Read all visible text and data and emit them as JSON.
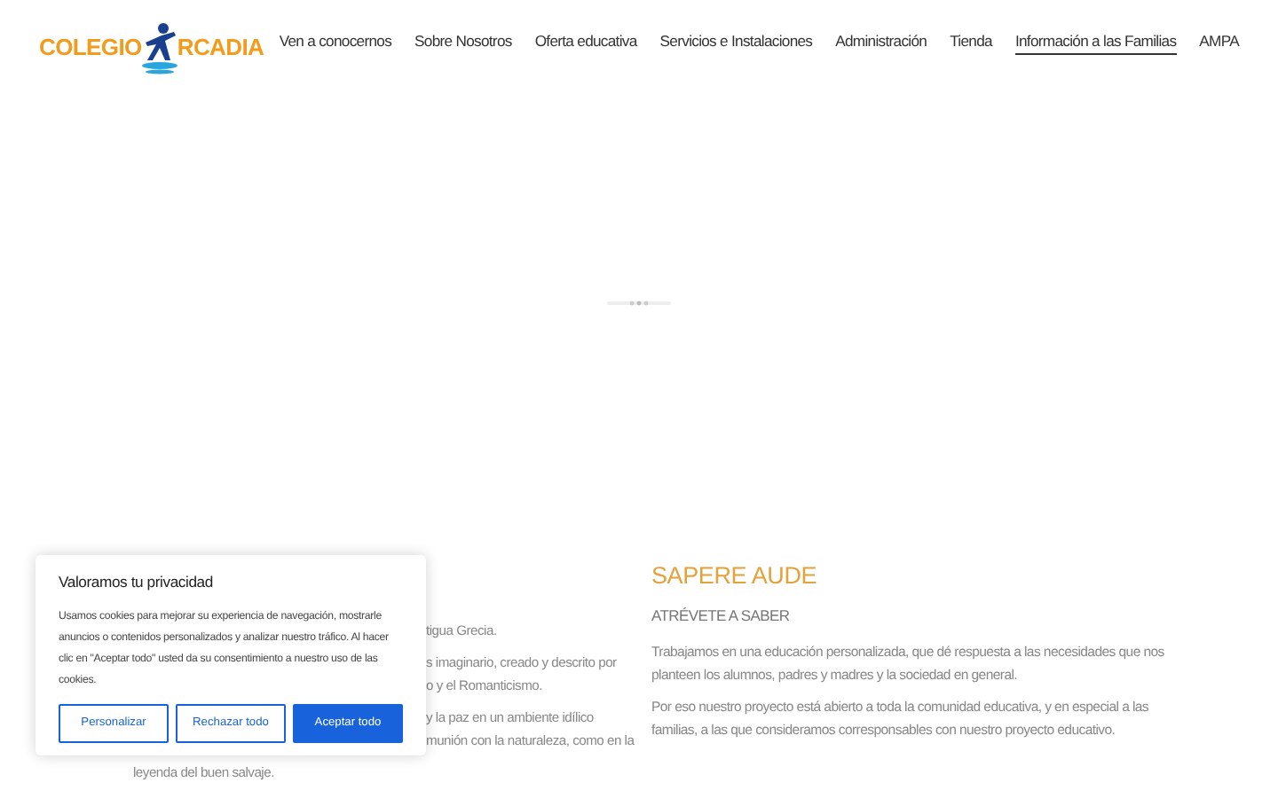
{
  "logo": {
    "text_left": "COLEGIO",
    "text_right": "RCADIA"
  },
  "nav": [
    {
      "label": "Ven a conocernos",
      "selected": false
    },
    {
      "label": "Sobre Nosotros",
      "selected": false
    },
    {
      "label": "Oferta educativa",
      "selected": false
    },
    {
      "label": "Servicios e Instalaciones",
      "selected": false
    },
    {
      "label": "Administración",
      "selected": false
    },
    {
      "label": "Tienda",
      "selected": false
    },
    {
      "label": "Información a las Familias",
      "selected": true
    },
    {
      "label": "AMPA",
      "selected": false
    }
  ],
  "left_column": {
    "paragraph_fragments": [
      [
        "tigua Grecia."
      ],
      [
        "s imaginario, creado y descrito por",
        "o y el Romanticismo."
      ],
      [
        "y la paz en un ambiente idílico",
        "munión con la naturaleza, como en la"
      ]
    ],
    "last_line": "leyenda del buen salvaje."
  },
  "right_column": {
    "title": "SAPERE AUDE",
    "subtitle": "ATRÉVETE A SABER",
    "paragraphs": [
      "Trabajamos en una educación personalizada, que dé respuesta a las necesidades que nos planteen los alumnos, padres y madres y la sociedad en general.",
      "Por eso nuestro proyecto está abierto a toda la comunidad educativa, y en especial a las familias, a las que consideramos corresponsables con nuestro proyecto educativo."
    ]
  },
  "cookie_banner": {
    "title": "Valoramos tu privacidad",
    "text": "Usamos cookies para mejorar su experiencia de navegación, mostrarle anuncios o contenidos personalizados y analizar nuestro tráfico. Al hacer clic en \"Aceptar todo\" usted da su consentimiento a nuestro uso de las cookies.",
    "buttons": [
      {
        "label": "Personalizar",
        "kind": "outline"
      },
      {
        "label": "Rechazar todo",
        "kind": "outline"
      },
      {
        "label": "Aceptar todo",
        "kind": "primary"
      }
    ]
  }
}
